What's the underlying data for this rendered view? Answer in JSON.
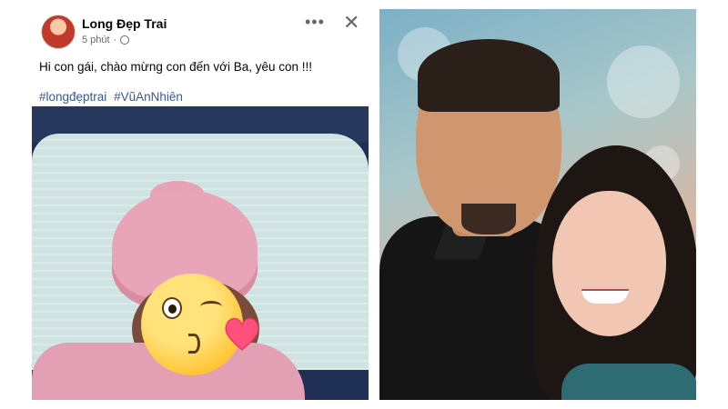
{
  "post": {
    "author": "Long Đẹp Trai",
    "time": "5 phút",
    "separator": "·",
    "icons": {
      "avatar": "profile-photo",
      "privacy": "globe-icon",
      "more": "more-options-icon",
      "close": "close-icon"
    },
    "more_glyph": "•••",
    "close_glyph": "✕",
    "text": "Hi con gái, chào mừng con đến với Ba, yêu con !!!",
    "hashtags": [
      "#longđẹptrai",
      "#VũAnNhiên"
    ]
  },
  "colors": {
    "hashtag": "#385898",
    "author": "#050505",
    "meta": "#65676b",
    "emoji_heart": "#ff4f7b"
  }
}
